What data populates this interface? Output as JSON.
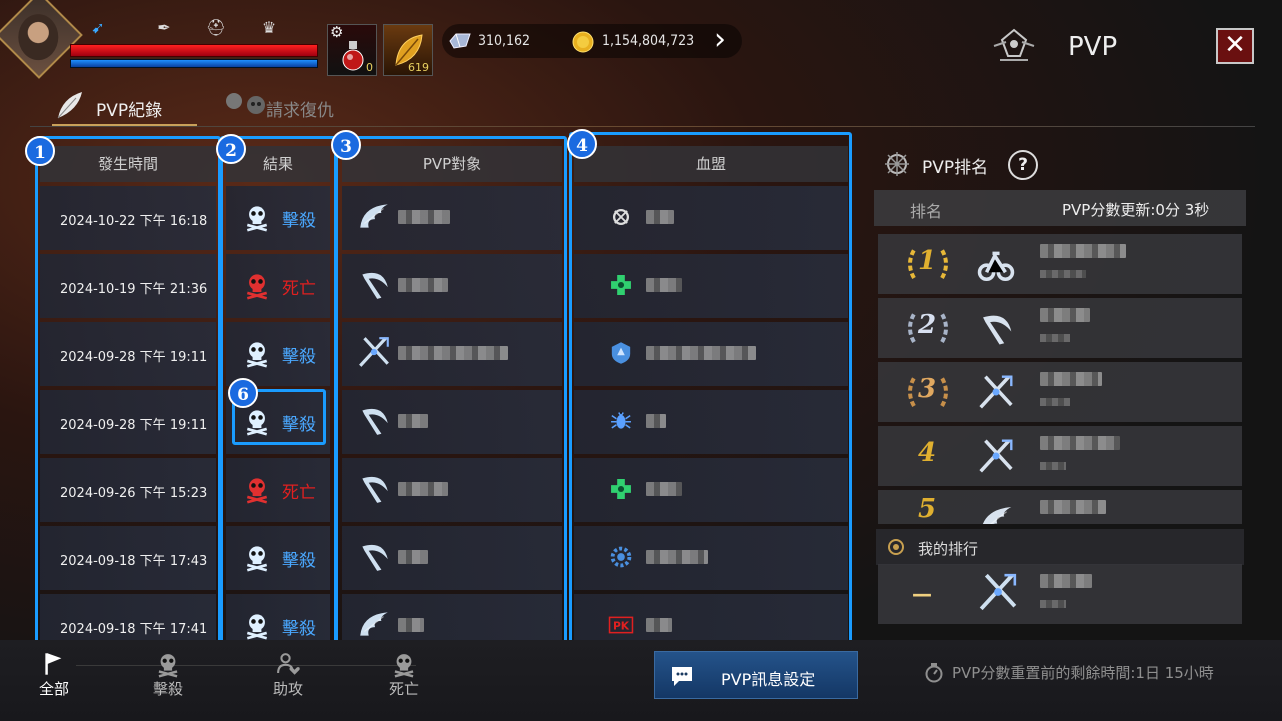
{
  "header": {
    "title": "PVP",
    "close_label": "✕",
    "slot1_count": "0",
    "slot2_count": "619",
    "diamonds": "310,162",
    "gold": "1,154,804,723",
    "arrow": "›"
  },
  "tabs": [
    {
      "label": "PVP紀錄",
      "active": true
    },
    {
      "label": "請求復仇",
      "active": false
    }
  ],
  "table": {
    "headers": [
      "發生時間",
      "結果",
      "PVP對象",
      "血盟"
    ],
    "rows": [
      {
        "date": "2024-10-22 下午 16:18",
        "result": "擊殺",
        "type": "kill",
        "class_icon": "wing-icon",
        "clan_icon": "crossed-circle-icon",
        "clan_color": "#dddddd"
      },
      {
        "date": "2024-10-19 下午 21:36",
        "result": "死亡",
        "type": "death",
        "class_icon": "scythe-icon",
        "clan_icon": "green-cross-icon",
        "clan_color": "#30d070"
      },
      {
        "date": "2024-09-28 下午 19:11",
        "result": "擊殺",
        "type": "kill",
        "class_icon": "crossed-swords-icon",
        "clan_icon": "blue-shield-icon",
        "clan_color": "#4a90e0"
      },
      {
        "date": "2024-09-28 下午 19:11",
        "result": "擊殺",
        "type": "kill",
        "class_icon": "scythe-icon",
        "clan_icon": "blue-bug-icon",
        "clan_color": "#5aa0ff"
      },
      {
        "date": "2024-09-26 下午 15:23",
        "result": "死亡",
        "type": "death",
        "class_icon": "scythe-icon",
        "clan_icon": "green-cross-icon",
        "clan_color": "#30d070"
      },
      {
        "date": "2024-09-18 下午 17:43",
        "result": "擊殺",
        "type": "kill",
        "class_icon": "scythe-icon",
        "clan_icon": "blue-gear-icon",
        "clan_color": "#4a90e0"
      },
      {
        "date": "2024-09-18 下午 17:41",
        "result": "擊殺",
        "type": "kill",
        "class_icon": "wing-icon",
        "clan_icon": "pk-icon",
        "clan_color": "#e02020"
      }
    ]
  },
  "badges": [
    "1",
    "2",
    "3",
    "4",
    "5",
    "6"
  ],
  "ranking": {
    "title": "PVP排名",
    "help": "?",
    "col_rank": "排名",
    "update_label": "PVP分數更新:0分 3秒",
    "entries": [
      {
        "rank": "1",
        "class_icon": "bike-icon"
      },
      {
        "rank": "2",
        "class_icon": "scythe-icon"
      },
      {
        "rank": "3",
        "class_icon": "crossed-swords-icon"
      },
      {
        "rank": "4",
        "class_icon": "crossed-swords-icon"
      },
      {
        "rank": "5",
        "class_icon": "wing-icon"
      }
    ],
    "my_rank_label": "我的排行",
    "my_rank_value": "—",
    "my_class_icon": "crossed-swords-icon"
  },
  "filters": [
    {
      "label": "全部",
      "icon": "flag-icon",
      "active": true
    },
    {
      "label": "擊殺",
      "icon": "skull-icon",
      "active": false
    },
    {
      "label": "助攻",
      "icon": "assist-icon",
      "active": false
    },
    {
      "label": "死亡",
      "icon": "skull-icon",
      "active": false
    }
  ],
  "footer": {
    "msg_button": "PVP訊息設定",
    "reset_text": "PVP分數重置前的剩餘時間:1日 15小時"
  },
  "colors": {
    "accent": "#1a9cff",
    "kill": "#4aa8ff",
    "death": "#e02020",
    "gold": "#e0b030"
  }
}
